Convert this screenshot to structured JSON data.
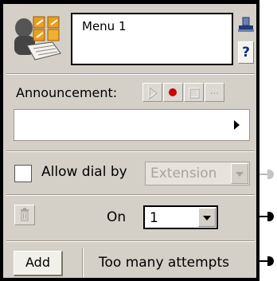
{
  "node": {
    "name": "Menu 1",
    "help_label": "?"
  },
  "announcement": {
    "label": "Announcement:",
    "tools": [
      "play-icon",
      "record-icon",
      "stop-icon",
      "browse-icon"
    ],
    "browse_label": "...",
    "value": ""
  },
  "dial": {
    "checked": false,
    "label": "Allow dial by",
    "selected": "Extension"
  },
  "on_row": {
    "label": "On",
    "selected": "1"
  },
  "add_row": {
    "add_label": "Add",
    "label": "Too many attempts"
  },
  "colors": {
    "panel": "#d4d0c8",
    "border": "#000000",
    "record": "#cc0000",
    "help": "#0a2d8c",
    "disabled_text": "#a8a49c"
  }
}
